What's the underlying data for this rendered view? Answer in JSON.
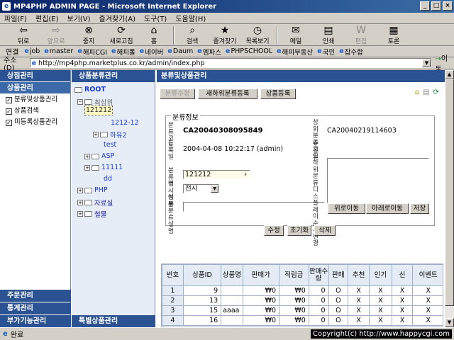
{
  "window": {
    "title": "MP4PHP ADMIN PAGE - Microsoft Internet Explorer",
    "minimize": "_",
    "maximize": "□",
    "close": "×"
  },
  "menu": [
    "파일(F)",
    "편집(E)",
    "보기(V)",
    "즐겨찾기(A)",
    "도구(T)",
    "도움말(H)"
  ],
  "toolbar": {
    "back": "뒤로",
    "forward": "앞으로",
    "stop": "중지",
    "refresh": "새로고침",
    "home": "홈",
    "search": "검색",
    "favorites": "즐겨찾기",
    "history": "목록보기",
    "mail": "메일",
    "print": "인쇄",
    "edit": "편집",
    "discuss": "토론"
  },
  "links": {
    "label": "연결",
    "items": [
      "job",
      "master",
      "해피CGI",
      "해피폴",
      "네이버",
      "Daum",
      "엠파스",
      "PHPSCHOOL",
      "해피부동산",
      "국민",
      "잡수함"
    ]
  },
  "address": {
    "label": "주소(D)",
    "url": "http://mp4php.marketplus.co.kr/admin/index.php",
    "go": "이동"
  },
  "status": {
    "text": "완료",
    "copyright": "Copyright(c) http://www.happycgi.com"
  },
  "leftnav": {
    "head1": "상점관리",
    "head2": "상품관리",
    "items": [
      "분류및상품관리",
      "상품검색",
      "미등록상품관리"
    ],
    "bottom": [
      "주문관리",
      "통계관리",
      "부가기능관리"
    ]
  },
  "tree": {
    "head": "상품분류관리",
    "root": "ROOT",
    "nodes": [
      "최상위",
      "121212",
      "1212-12",
      "하유2",
      "test",
      "ASP",
      "11111",
      "dd",
      "PHP",
      "자료실",
      "철물"
    ],
    "bottom": "특별상품관리"
  },
  "main": {
    "head": "분류및상품관리",
    "buttons": {
      "edit_cat": "분류수정",
      "new_sub": "새하위분류등록",
      "product_reg": "상품등록"
    },
    "group_label": "분류정보",
    "labels": {
      "code": "분류코드",
      "regdate": "등록일",
      "name": "분류명",
      "display": "전시여부",
      "desc": "상품분류설명",
      "parent_code": "상위분류코드",
      "modified": "수정일",
      "sub_display_order": "하위분류디스플레이순서변경"
    },
    "values": {
      "code": "CA20040308095849",
      "regdate": "2004-04-08 10:22:17 (admin)",
      "parent_code": "CA20040219114603",
      "name": "121212",
      "display": "전시"
    },
    "order_buttons": {
      "up": "위로이동",
      "down": "아래로이동",
      "save": "저장"
    },
    "action_buttons": {
      "edit": "수정",
      "reset": "초기화",
      "delete": "삭제"
    }
  },
  "table": {
    "headers": [
      "번호",
      "상품ID",
      "상품명",
      "판매가",
      "적립금",
      "판매수량",
      "판매",
      "추천",
      "인기",
      "신",
      "이벤트"
    ],
    "rows": [
      [
        "1",
        "9",
        "",
        "₩0",
        "₩0",
        "0",
        "O",
        "X",
        "X",
        "X",
        "X"
      ],
      [
        "2",
        "13",
        "",
        "₩0",
        "₩0",
        "0",
        "O",
        "X",
        "X",
        "X",
        "X"
      ],
      [
        "3",
        "15",
        "aaaa",
        "₩0",
        "₩0",
        "0",
        "O",
        "X",
        "X",
        "X",
        "X"
      ],
      [
        "4",
        "16",
        "",
        "₩0",
        "₩0",
        "0",
        "O",
        "X",
        "X",
        "X",
        "X"
      ]
    ]
  }
}
